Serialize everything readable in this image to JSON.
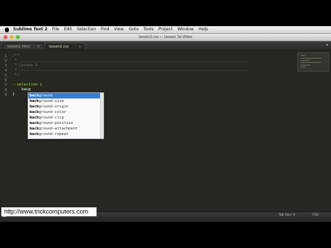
{
  "menubar": {
    "app_name": "Sublime Text 2",
    "items": [
      "File",
      "Edit",
      "Selection",
      "Find",
      "View",
      "Goto",
      "Tools",
      "Project",
      "Window",
      "Help"
    ]
  },
  "window": {
    "title": "lesson2.css — Lesson 3a Video"
  },
  "tabs": [
    {
      "label": "lesson1.html",
      "close": "×"
    },
    {
      "label": "lesson2.css",
      "close": "×"
    }
  ],
  "tab_more": "▾",
  "editor": {
    "line_numbers": [
      "1",
      "2",
      "3",
      "4",
      "5",
      "6",
      "7",
      "8",
      "9"
    ],
    "lines": [
      "/**",
      " *",
      " * Lesson 3",
      " *",
      " */",
      "",
      "::selection {",
      "    bacg",
      "}"
    ]
  },
  "autocomplete": {
    "items": [
      {
        "match": "bac",
        "b2": "k",
        "rest": "ground"
      },
      {
        "match": "bac",
        "b2": "k",
        "rest": "ground-size"
      },
      {
        "match": "bac",
        "b2": "k",
        "rest": "ground-origin"
      },
      {
        "match": "bac",
        "b2": "k",
        "rest": "ground-color"
      },
      {
        "match": "bac",
        "b2": "k",
        "rest": "ground-clip"
      },
      {
        "match": "bac",
        "b2": "k",
        "rest": "ground-position"
      },
      {
        "match": "bac",
        "b2": "k",
        "rest": "ground-attachment"
      },
      {
        "match": "bac",
        "b2": "k",
        "rest": "ground-repeat"
      }
    ]
  },
  "statusbar": {
    "tab_size": "Tab Size: 4",
    "syntax": "CSS"
  },
  "watermark": "http://www.trickcomputers.com",
  "colors": {
    "editor_bg": "#272822",
    "comment": "#75715e",
    "selector": "#a6e22e",
    "selection_blue": "#3b7bd0"
  }
}
